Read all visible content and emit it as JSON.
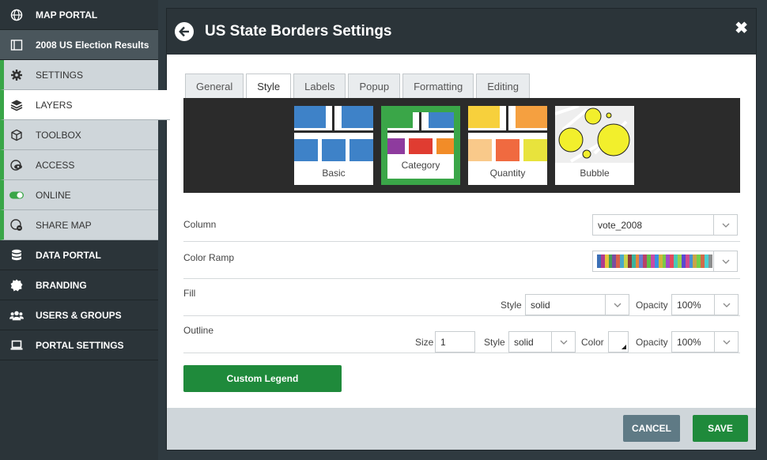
{
  "sidebar": {
    "items": [
      {
        "label": "MAP PORTAL",
        "icon": "globe-icon"
      },
      {
        "label": "2008 US Election Results",
        "icon": "map-book-icon"
      },
      {
        "label": "SETTINGS",
        "icon": "gear-icon"
      },
      {
        "label": "LAYERS",
        "icon": "layers-icon"
      },
      {
        "label": "TOOLBOX",
        "icon": "cube-icon"
      },
      {
        "label": "ACCESS",
        "icon": "eye-globe-icon"
      },
      {
        "label": "ONLINE",
        "icon": "toggle-icon"
      },
      {
        "label": "SHARE MAP",
        "icon": "share-globe-icon"
      },
      {
        "label": "DATA PORTAL",
        "icon": "database-icon"
      },
      {
        "label": "BRANDING",
        "icon": "badge-icon"
      },
      {
        "label": "USERS & GROUPS",
        "icon": "users-icon"
      },
      {
        "label": "PORTAL SETTINGS",
        "icon": "laptop-icon"
      }
    ]
  },
  "modal": {
    "title": "US State Borders Settings",
    "tabs": [
      "General",
      "Style",
      "Labels",
      "Popup",
      "Formatting",
      "Editing"
    ],
    "active_tab": "Style",
    "style_types": [
      "Basic",
      "Category",
      "Quantity",
      "Bubble"
    ],
    "selected_style": "Category",
    "column": {
      "label": "Column",
      "value": "vote_2008"
    },
    "color_ramp": {
      "label": "Color Ramp"
    },
    "fill": {
      "label": "Fill",
      "style_label": "Style",
      "style_value": "solid",
      "opacity_label": "Opacity",
      "opacity_value": "100%"
    },
    "outline": {
      "label": "Outline",
      "size_label": "Size",
      "size_value": "1",
      "style_label": "Style",
      "style_value": "solid",
      "color_label": "Color",
      "opacity_label": "Opacity",
      "opacity_value": "100%"
    },
    "custom_legend": "Custom Legend",
    "cancel": "CANCEL",
    "save": "SAVE"
  },
  "colors": {
    "accent_green": "#1f8a3b",
    "active_border": "#3aa648",
    "sidebar_bg": "#2b3439",
    "ramp": [
      "#3b6fb6",
      "#b23b8c",
      "#e8c23a",
      "#42a05a",
      "#7a4fa0",
      "#d9604a",
      "#4aa9c9",
      "#c7d34a",
      "#8e3b3b",
      "#3bb39e",
      "#e3873a",
      "#6a7bd1",
      "#b8426a",
      "#5fbf4a",
      "#c94aa7",
      "#3a8fe3",
      "#d1b53a",
      "#7bc94a",
      "#a34ac9",
      "#e34a5f",
      "#4ac9b8",
      "#9bd14a",
      "#5a4ad1",
      "#d14a8e",
      "#4a92d1",
      "#c9a44a",
      "#71d14a",
      "#d16a4a",
      "#4ad1d1",
      "#8f8f8f"
    ]
  }
}
